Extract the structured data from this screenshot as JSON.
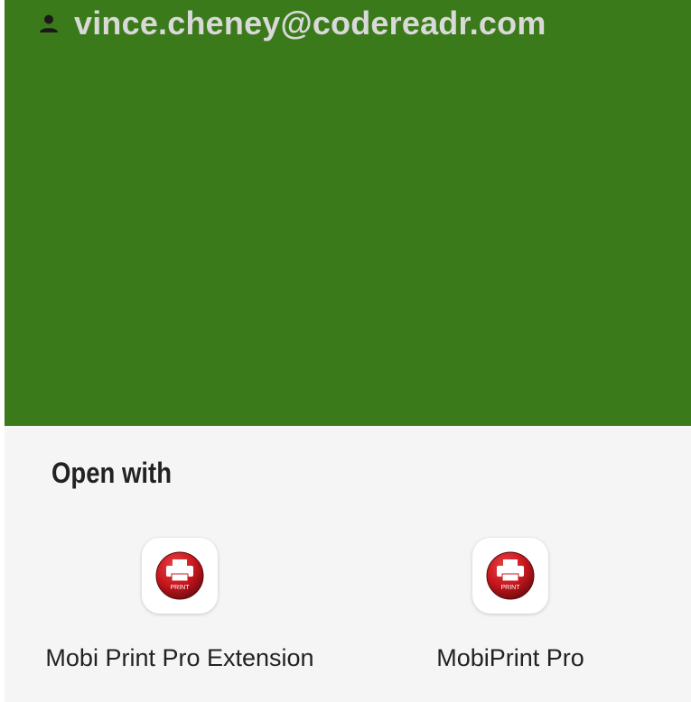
{
  "account": {
    "email": "vince.cheney@codereadr.com",
    "icon": "person-icon"
  },
  "colors": {
    "header_green": "#3b7a1a",
    "sheet_bg": "#f5f5f5",
    "print_red": "#c8161d"
  },
  "sheet": {
    "title": "Open with",
    "apps": [
      {
        "label": "Mobi Print Pro Extension",
        "icon": "print-app-icon",
        "icon_text": "PRINT"
      },
      {
        "label": "MobiPrint Pro",
        "icon": "print-app-icon",
        "icon_text": "PRINT"
      }
    ]
  }
}
